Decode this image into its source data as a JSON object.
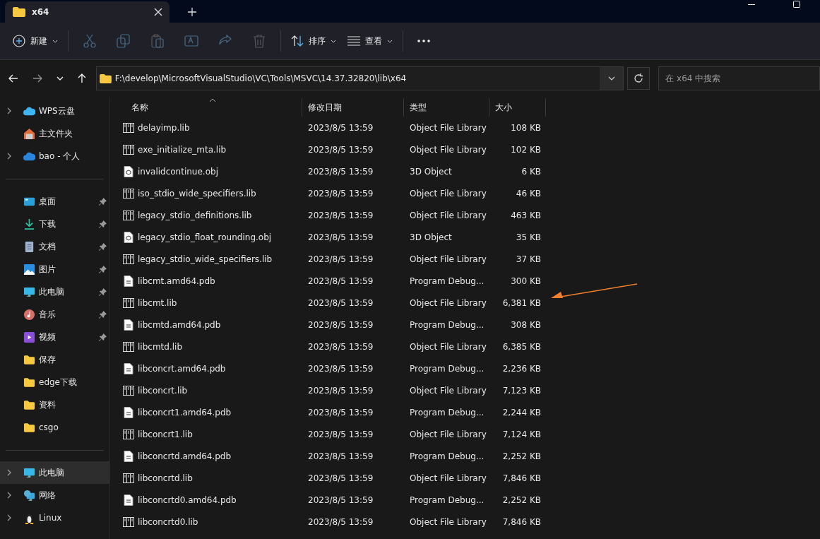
{
  "tab": {
    "title": "x64",
    "selected": true
  },
  "toolbar": [
    {
      "kind": "new",
      "label": "新建",
      "disabled": false
    },
    {
      "kind": "cut",
      "disabled": true
    },
    {
      "kind": "copy",
      "disabled": true
    },
    {
      "kind": "paste",
      "disabled": true
    },
    {
      "kind": "rename",
      "disabled": true
    },
    {
      "kind": "share",
      "disabled": true
    },
    {
      "kind": "delete",
      "disabled": true
    },
    {
      "kind": "sort",
      "label": "排序",
      "disabled": false
    },
    {
      "kind": "view",
      "label": "查看",
      "disabled": false
    },
    {
      "kind": "more"
    }
  ],
  "nav": {
    "forward_disabled": true
  },
  "address": {
    "path": "F:\\develop\\MicrosoftVisualStudio\\VC\\Tools\\MSVC\\14.37.32820\\lib\\x64"
  },
  "search": {
    "placeholder": "在 x64 中搜索"
  },
  "sidebar": [
    [
      {
        "kind": "wps",
        "label": "WPS云盘",
        "expandable": true,
        "pinned": false,
        "selected": false
      },
      {
        "kind": "home",
        "label": "主文件夹",
        "expandable": false,
        "pinned": false,
        "selected": false
      },
      {
        "kind": "cloud",
        "label": "bao - 个人",
        "expandable": true,
        "pinned": false,
        "selected": false
      }
    ],
    [
      {
        "kind": "desktop",
        "label": "桌面",
        "expandable": false,
        "pinned": true,
        "selected": false
      },
      {
        "kind": "download",
        "label": "下载",
        "expandable": false,
        "pinned": true,
        "selected": false
      },
      {
        "kind": "document",
        "label": "文档",
        "expandable": false,
        "pinned": true,
        "selected": false
      },
      {
        "kind": "image",
        "label": "图片",
        "expandable": false,
        "pinned": true,
        "selected": false
      },
      {
        "kind": "pc",
        "label": "此电脑",
        "expandable": false,
        "pinned": true,
        "selected": false
      },
      {
        "kind": "music",
        "label": "音乐",
        "expandable": false,
        "pinned": true,
        "selected": false
      },
      {
        "kind": "video",
        "label": "视频",
        "expandable": false,
        "pinned": true,
        "selected": false
      },
      {
        "kind": "folder",
        "label": "保存",
        "expandable": false,
        "pinned": false,
        "selected": false
      },
      {
        "kind": "folder",
        "label": "edge下载",
        "expandable": false,
        "pinned": false,
        "selected": false
      },
      {
        "kind": "folder",
        "label": "资料",
        "expandable": false,
        "pinned": false,
        "selected": false
      },
      {
        "kind": "folder",
        "label": "csgo",
        "expandable": false,
        "pinned": false,
        "selected": false
      }
    ],
    [
      {
        "kind": "pc",
        "label": "此电脑",
        "expandable": true,
        "pinned": false,
        "selected": true
      },
      {
        "kind": "network",
        "label": "网络",
        "expandable": true,
        "pinned": false,
        "selected": false
      },
      {
        "kind": "linux",
        "label": "Linux",
        "expandable": true,
        "pinned": false,
        "selected": false
      }
    ]
  ],
  "table": {
    "columns": [
      {
        "label": "名称",
        "sorted": true
      },
      {
        "label": "修改日期",
        "sorted": false
      },
      {
        "label": "类型",
        "sorted": false
      },
      {
        "label": "大小",
        "sorted": false
      }
    ],
    "rows": [
      {
        "kind": "lib",
        "name": "delayimp.lib",
        "date": "2023/8/5 13:59",
        "type": "Object File Library",
        "size": "108 KB"
      },
      {
        "kind": "lib",
        "name": "exe_initialize_mta.lib",
        "date": "2023/8/5 13:59",
        "type": "Object File Library",
        "size": "102 KB"
      },
      {
        "kind": "obj",
        "name": "invalidcontinue.obj",
        "date": "2023/8/5 13:59",
        "type": "3D Object",
        "size": "6 KB"
      },
      {
        "kind": "lib",
        "name": "iso_stdio_wide_specifiers.lib",
        "date": "2023/8/5 13:59",
        "type": "Object File Library",
        "size": "46 KB"
      },
      {
        "kind": "lib",
        "name": "legacy_stdio_definitions.lib",
        "date": "2023/8/5 13:59",
        "type": "Object File Library",
        "size": "463 KB"
      },
      {
        "kind": "obj",
        "name": "legacy_stdio_float_rounding.obj",
        "date": "2023/8/5 13:59",
        "type": "3D Object",
        "size": "35 KB"
      },
      {
        "kind": "lib",
        "name": "legacy_stdio_wide_specifiers.lib",
        "date": "2023/8/5 13:59",
        "type": "Object File Library",
        "size": "37 KB"
      },
      {
        "kind": "pdb",
        "name": "libcmt.amd64.pdb",
        "date": "2023/8/5 13:59",
        "type": "Program Debug...",
        "size": "300 KB"
      },
      {
        "kind": "lib",
        "name": "libcmt.lib",
        "date": "2023/8/5 13:59",
        "type": "Object File Library",
        "size": "6,381 KB"
      },
      {
        "kind": "pdb",
        "name": "libcmtd.amd64.pdb",
        "date": "2023/8/5 13:59",
        "type": "Program Debug...",
        "size": "308 KB"
      },
      {
        "kind": "lib",
        "name": "libcmtd.lib",
        "date": "2023/8/5 13:59",
        "type": "Object File Library",
        "size": "6,385 KB"
      },
      {
        "kind": "pdb",
        "name": "libconcrt.amd64.pdb",
        "date": "2023/8/5 13:59",
        "type": "Program Debug...",
        "size": "2,236 KB"
      },
      {
        "kind": "lib",
        "name": "libconcrt.lib",
        "date": "2023/8/5 13:59",
        "type": "Object File Library",
        "size": "7,123 KB"
      },
      {
        "kind": "pdb",
        "name": "libconcrt1.amd64.pdb",
        "date": "2023/8/5 13:59",
        "type": "Program Debug...",
        "size": "2,244 KB"
      },
      {
        "kind": "lib",
        "name": "libconcrt1.lib",
        "date": "2023/8/5 13:59",
        "type": "Object File Library",
        "size": "7,124 KB"
      },
      {
        "kind": "pdb",
        "name": "libconcrtd.amd64.pdb",
        "date": "2023/8/5 13:59",
        "type": "Program Debug...",
        "size": "2,252 KB"
      },
      {
        "kind": "lib",
        "name": "libconcrtd.lib",
        "date": "2023/8/5 13:59",
        "type": "Object File Library",
        "size": "7,846 KB"
      },
      {
        "kind": "pdb",
        "name": "libconcrtd0.amd64.pdb",
        "date": "2023/8/5 13:59",
        "type": "Program Debug...",
        "size": "2,252 KB"
      },
      {
        "kind": "lib",
        "name": "libconcrtd0.lib",
        "date": "2023/8/5 13:59",
        "type": "Object File Library",
        "size": "7,846 KB"
      }
    ]
  }
}
